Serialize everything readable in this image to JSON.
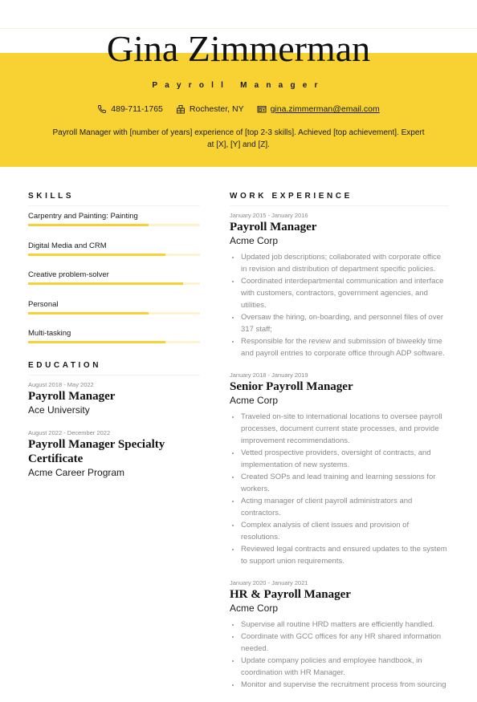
{
  "header": {
    "name": "Gina Zimmerman",
    "role": "Payroll Manager",
    "phone": "489-711-1765",
    "location": "Rochester, NY",
    "email": "gina.zimmerman@email.com",
    "summary": "Payroll Manager with [number of years] experience of [top 2-3 skills]. Achieved [top achievement]. Expert at [X], [Y] and [Z].",
    "icons": {
      "phone": "phone-icon",
      "location": "building-icon",
      "email": "id-card-icon"
    }
  },
  "colors": {
    "accent": "#f7d232",
    "accent_light": "#fdf4cf",
    "muted": "#8a8a8a"
  },
  "skills": {
    "title": "SKILLS",
    "items": [
      {
        "name": "Carpentry and Painting: Painting",
        "level": 0.7
      },
      {
        "name": "Digital Media and CRM",
        "level": 0.8
      },
      {
        "name": "Creative problem-solver",
        "level": 0.9
      },
      {
        "name": "Personal",
        "level": 0.7
      },
      {
        "name": "Multi-tasking",
        "level": 0.8
      }
    ]
  },
  "education": {
    "title": "EDUCATION",
    "items": [
      {
        "dates": "August 2018 - May 2022",
        "degree": "Payroll Manager",
        "school": "Ace University"
      },
      {
        "dates": "August 2022 - December 2022",
        "degree": "Payroll Manager Specialty Certificate",
        "school": "Acme Career Program"
      }
    ]
  },
  "experience": {
    "title": "WORK EXPERIENCE",
    "jobs": [
      {
        "dates": "January 2015 - January 2016",
        "title": "Payroll Manager",
        "company": "Acme Corp",
        "bullets": [
          "Updated job descriptions; collaborated with corporate office in revision and distribution of department specific policies.",
          "Coordinated interdepartmental communication and interface with customers, contractors, government agencies, and utilities.",
          "Oversaw the hiring, on-boarding, and personnel files of over 317 staff;",
          "Responsible for the review and submission of biweekly time and payroll entries to corporate office through ADP software."
        ]
      },
      {
        "dates": "January 2018 - January 2019",
        "title": "Senior Payroll Manager",
        "company": "Acme Corp",
        "bullets": [
          "Traveled on-site to international locations to oversee payroll processes, document current state processes, and provide improvement recommendations.",
          "Vetted prospective providers, oversight of contracts, and implementation of new systems.",
          "Created SOPs and lead training and learning sessions for workers.",
          "Acting manager of client payroll administrators and contractors.",
          "Complex analysis of client issues and provision of resolutions.",
          "Reviewed legal contracts and ensured updates to the system to support union requirements."
        ]
      },
      {
        "dates": "January 2020 - January 2021",
        "title": "HR & Payroll Manager",
        "company": "Acme Corp",
        "bullets": [
          "Supervise all routine HRD matters are efficiently handled.",
          "Coordinate with GCC offices for any HR shared information needed.",
          "Update company policies and employee handbook, in coordination with HR Manager.",
          "Monitor and supervise the recruitment process from sourcing"
        ]
      }
    ]
  }
}
